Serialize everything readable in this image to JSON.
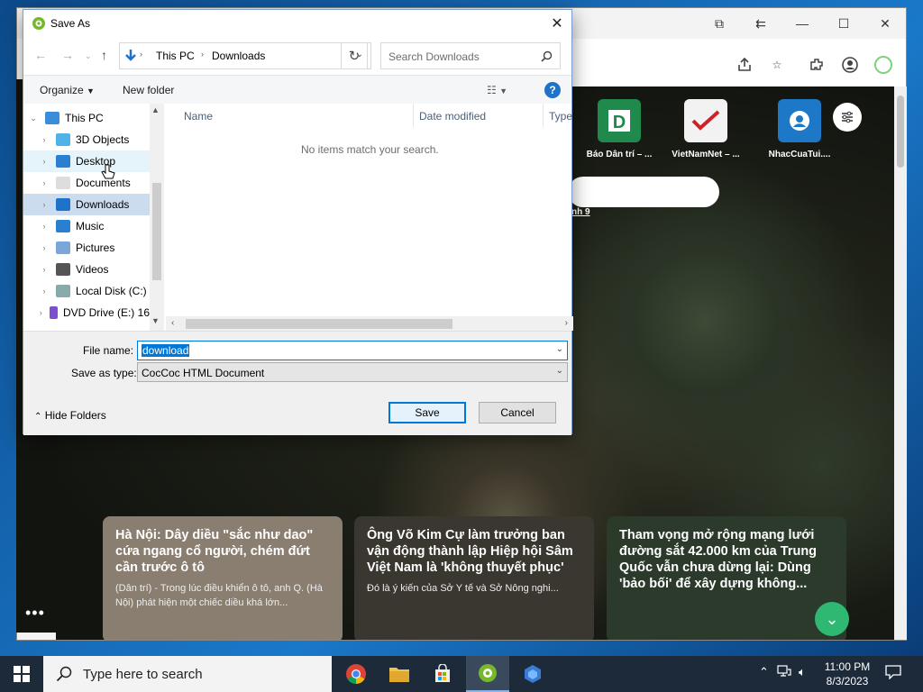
{
  "dialog": {
    "title": "Save As",
    "address": {
      "root": "This PC",
      "folder": "Downloads"
    },
    "search_placeholder": "Search Downloads",
    "toolbar": {
      "organize": "Organize",
      "new_folder": "New folder"
    },
    "nav_items": [
      {
        "label": "This PC",
        "icon": "computer-icon",
        "expanded": true
      },
      {
        "label": "3D Objects",
        "icon": "cube-icon"
      },
      {
        "label": "Desktop",
        "icon": "desktop-icon",
        "hover": true
      },
      {
        "label": "Documents",
        "icon": "document-icon"
      },
      {
        "label": "Downloads",
        "icon": "download-arrow-icon",
        "selected": true
      },
      {
        "label": "Music",
        "icon": "music-note-icon"
      },
      {
        "label": "Pictures",
        "icon": "picture-icon"
      },
      {
        "label": "Videos",
        "icon": "film-icon"
      },
      {
        "label": "Local Disk (C:)",
        "icon": "drive-icon"
      },
      {
        "label": "DVD Drive (E:) 16",
        "icon": "dvd-icon"
      }
    ],
    "columns": [
      "Name",
      "Date modified",
      "Type"
    ],
    "empty_message": "No items match your search.",
    "file_name_label": "File name:",
    "file_name_value": "download",
    "save_type_label": "Save as type:",
    "save_type_value": "CocCoc HTML Document",
    "hide_folders": "Hide Folders",
    "save_button": "Save",
    "cancel_button": "Cancel"
  },
  "browser": {
    "shortcuts": [
      {
        "label": "Báo Dân trí – ...",
        "icon": "dantri-icon",
        "color": "#1f8a4c"
      },
      {
        "label": "VietNamNet – ...",
        "icon": "vietnamnet-icon",
        "color": "#f2f2f2"
      },
      {
        "label": "NhacCuaTui....",
        "icon": "nhaccuatui-icon",
        "color": "#1e78c8"
      }
    ],
    "link_fragment": "nh 9",
    "cards": [
      {
        "title": "Hà Nội: Dây diều \"sắc như dao\" cứa ngang cổ người, chém đứt cần trước ô tô",
        "summary": "(Dân trí) - Trong lúc điều khiển ô tô, anh Q. (Hà Nội) phát hiện một chiếc diều khá lớn...",
        "color": "#8a7e70"
      },
      {
        "title": "Ông Võ Kim Cự làm trưởng ban vận động thành lập Hiệp hội Sâm Việt Nam là 'không thuyết phục'",
        "summary": "Đó là ý kiến của Sở Y tế và Sở Nông nghi...",
        "color": "#3a3630"
      },
      {
        "title": "Tham vọng mở rộng mạng lưới đường sắt 42.000 km của Trung Quốc vẫn chưa dừng lại: Dùng 'bảo bối' để xây dựng không...",
        "summary": "",
        "color": "#2b3a2a"
      }
    ]
  },
  "taskbar": {
    "search_placeholder": "Type here to search",
    "time": "11:00 PM",
    "date": "8/3/2023"
  }
}
